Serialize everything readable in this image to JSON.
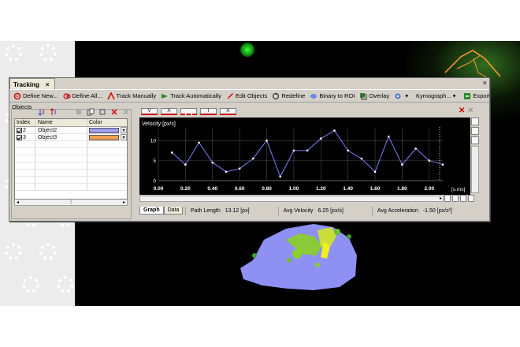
{
  "window": {
    "tab_title": "Tracking",
    "tab_close": "×",
    "close": "×"
  },
  "toolbar": {
    "items": [
      {
        "label": "Define New..."
      },
      {
        "label": "Define All..."
      },
      {
        "label": "Track Manually"
      },
      {
        "label": "Track Automatically"
      },
      {
        "label": "Edit Objects"
      },
      {
        "label": "Redefine"
      },
      {
        "label": "Binary to ROI"
      },
      {
        "label": "Overlay"
      },
      {
        "label": ""
      },
      {
        "label": "Kymograph..."
      },
      {
        "label": "Export"
      }
    ],
    "dropdown_arrow": "▾"
  },
  "objects": {
    "group_label": "Objects",
    "columns": [
      "Index",
      "Name",
      "Color"
    ],
    "rows": [
      {
        "index": "2",
        "name": "Object2",
        "color": "#9c9cf0"
      },
      {
        "index": "3",
        "name": "Object3",
        "color": "#f0a050"
      }
    ]
  },
  "graph_tabs": {
    "items": [
      "V",
      "A",
      "",
      "I",
      "A"
    ]
  },
  "bottom_tabs": [
    "Graph",
    "Data"
  ],
  "status": {
    "path_length_label": "Path Length",
    "path_length_value": "13.12 [px]",
    "avg_velocity_label": "Avg Velocity",
    "avg_velocity_value": "6.25 [px/s]",
    "avg_accel_label": "Avg Acceleration",
    "avg_accel_value": "-1.50 [px/s²]"
  },
  "chart_data": {
    "type": "line",
    "title": "Velocity [px/s]",
    "xlabel": "[s.ms]",
    "ylabel": "Velocity [px/s]",
    "xlim": [
      0,
      2.1
    ],
    "ylim": [
      0,
      13
    ],
    "xticks": [
      "0.00",
      "0.20",
      "0.40",
      "0.60",
      "0.80",
      "1.00",
      "1.20",
      "1.40",
      "1.60",
      "1.80",
      "2.00"
    ],
    "yticks": [
      "0",
      "5",
      "10"
    ],
    "grid": true,
    "series": [
      {
        "name": "",
        "color": "#8080ff",
        "x": [
          0.1,
          0.2,
          0.3,
          0.4,
          0.5,
          0.6,
          0.7,
          0.8,
          0.9,
          1.0,
          1.1,
          1.2,
          1.3,
          1.4,
          1.5,
          1.6,
          1.7,
          1.8,
          1.9,
          2.0,
          2.1
        ],
        "y": [
          7.0,
          4.0,
          9.5,
          4.5,
          2.2,
          3.0,
          5.5,
          10.0,
          1.0,
          7.5,
          7.5,
          10.5,
          12.5,
          7.5,
          5.5,
          2.2,
          11.0,
          4.0,
          8.0,
          5.0,
          4.0
        ]
      }
    ]
  }
}
